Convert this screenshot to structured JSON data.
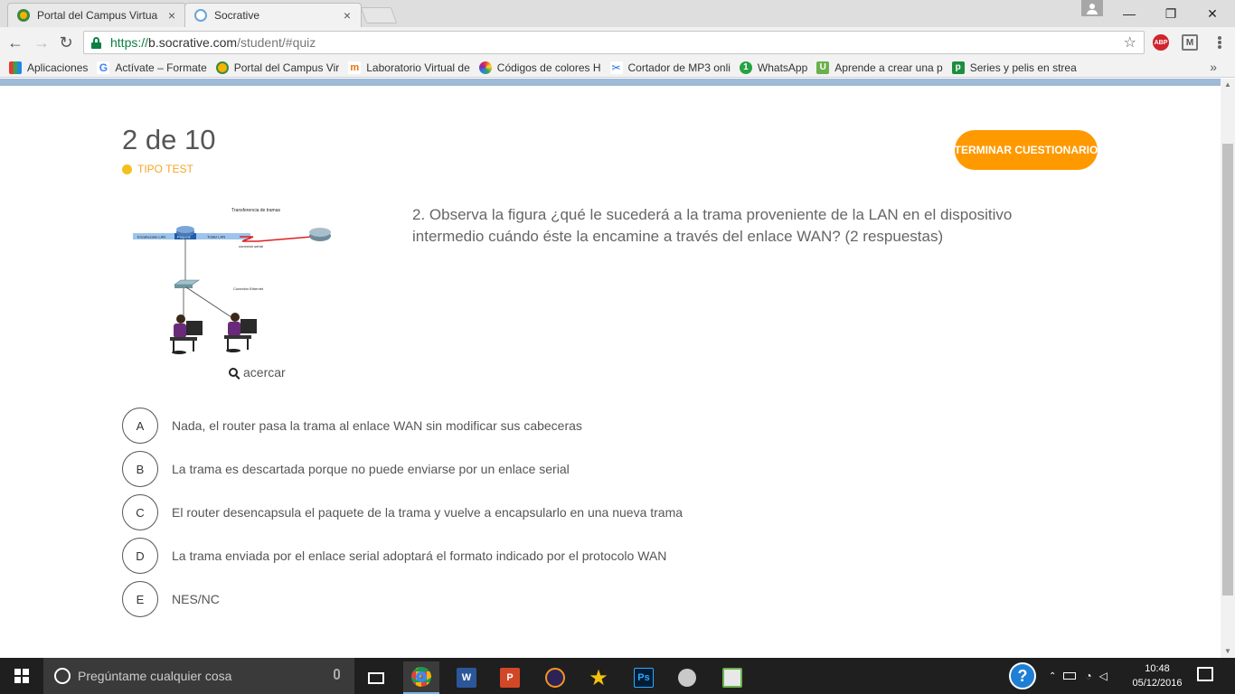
{
  "browser": {
    "tabs": [
      {
        "label": "Portal del Campus Virtua",
        "close": "×",
        "active": false
      },
      {
        "label": "Socrative",
        "close": "×",
        "active": true
      }
    ],
    "window_controls": {
      "minimize": "—",
      "restore": "❐",
      "close": "✕"
    },
    "url": {
      "scheme": "https://",
      "host": "b.socrative.com",
      "path": "/student/#quiz"
    },
    "extensions": {
      "abp": "ABP",
      "m": "M"
    },
    "bookmarks": [
      {
        "label": "Aplicaciones",
        "icon": "apps-grid-icon",
        "color": "#4285f4"
      },
      {
        "label": "Actívate – Formate",
        "icon": "google-icon",
        "color": "#4285f4"
      },
      {
        "label": "Portal del Campus Vir",
        "icon": "campus-icon",
        "color": "#f5b400"
      },
      {
        "label": "Laboratorio Virtual de",
        "icon": "lab-icon",
        "color": "#e8710a"
      },
      {
        "label": "Códigos de colores H",
        "icon": "color-wheel-icon",
        "color": "#c00"
      },
      {
        "label": "Cortador de MP3 onli",
        "icon": "scissors-icon",
        "color": "#1a73e8"
      },
      {
        "label": "WhatsApp",
        "icon": "whatsapp-icon",
        "color": "#25a244"
      },
      {
        "label": "Aprende a crear una p",
        "icon": "u-icon",
        "color": "#6ab04c"
      },
      {
        "label": "Series y pelis en strea",
        "icon": "p-icon",
        "color": "#1e8e3e"
      }
    ],
    "bookmarks_more": "»"
  },
  "quiz": {
    "counter": "2 de 10",
    "type_label": "TIPO TEST",
    "finish_button": "TERMINAR CUESTIONARIO",
    "question": "2. Observa la figura ¿qué le sucederá a la trama proveniente de la LAN en el dispositivo intermedio cuándo éste la encamine a través del enlace WAN? (2 respuestas)",
    "zoom_label": "acercar",
    "figure_labels": {
      "title": "Transferencia de tramas",
      "lan_header": "Encabezado LAN",
      "packet": "Paquete",
      "lan_trailer": "Tráiler LAN",
      "serial": "conexión serial",
      "ethernet": "Conexión Ethernet"
    },
    "answers": [
      {
        "letter": "A",
        "text": "Nada, el router pasa la trama al enlace WAN sin modificar sus cabeceras"
      },
      {
        "letter": "B",
        "text": "La trama es descartada porque no puede enviarse por un enlace serial"
      },
      {
        "letter": "C",
        "text": "El router desencapsula el paquete de la trama y vuelve a encapsularlo en una nueva trama"
      },
      {
        "letter": "D",
        "text": "La trama enviada por el enlace serial adoptará el formato indicado por el protocolo WAN"
      },
      {
        "letter": "E",
        "text": "NES/NC"
      }
    ]
  },
  "taskbar": {
    "search_placeholder": "Pregúntame cualquier cosa",
    "apps": [
      "task-view",
      "chrome",
      "word",
      "powerpoint",
      "eclipse",
      "star-app",
      "photoshop",
      "paint-app",
      "notepad-app"
    ],
    "app_letters": {
      "word": "W",
      "powerpoint": "P",
      "photoshop": "Ps"
    },
    "time": "10:48",
    "date": "05/12/2016",
    "help": "?"
  },
  "colors": {
    "accent_orange": "#ff9900",
    "type_dot": "#f2c11b",
    "header_strip": "#9fbad6"
  }
}
